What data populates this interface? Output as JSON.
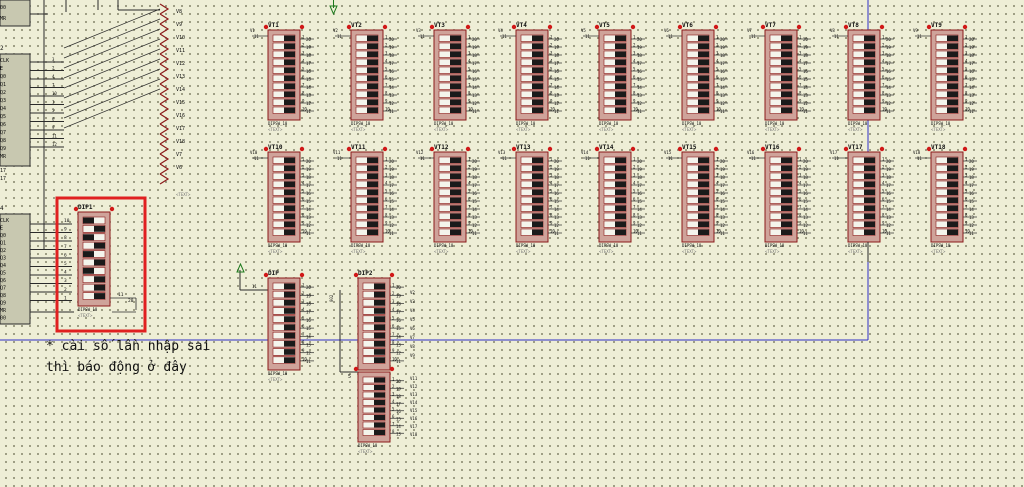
{
  "colors": {
    "background": "#eeeed6",
    "component_border": "#8b1a1a",
    "component_fill": "#cfa39a",
    "switch_on": "#1a1a1a",
    "switch_off": "#f4f4ec",
    "pin_dot": "#d01818",
    "wire": "#2b2b2b",
    "bus_wire": "#3030c8",
    "highlight_box": "#e02020",
    "ground_arrow": "#1d7a1d",
    "ic_fill": "#c8c8b0"
  },
  "ic_left": {
    "top_pins": [
      "00",
      "MR"
    ],
    "mid_label": "2",
    "mid_pins": [
      "CLK",
      "E",
      "Q0",
      "Q1",
      "Q2",
      "Q3",
      "Q4",
      "Q5",
      "Q6",
      "Q7",
      "Q8",
      "Q9",
      "MR"
    ],
    "mid_pin_numbers": [
      "3",
      "2",
      "4",
      "7",
      "10",
      "1",
      "5",
      "6",
      "9",
      "11",
      "12"
    ],
    "bottom_label": "4",
    "bottom_pins": [
      "CLK",
      "E",
      "Q0",
      "Q1",
      "Q2",
      "Q3",
      "Q4",
      "Q5",
      "Q6",
      "Q7",
      "Q8",
      "Q9",
      "MR",
      "00"
    ],
    "extra_labels": [
      "17",
      "17",
      "12",
      "15"
    ]
  },
  "resistor_labels": [
    "V8",
    "V9",
    "V10",
    "V11",
    "V12",
    "V13",
    "V14",
    "V15",
    "V16",
    "V17",
    "V18",
    "V7",
    "V6"
  ],
  "dip_rows": [
    [
      "VT1",
      "VT2",
      "VT3",
      "VT4",
      "VT5",
      "VT6",
      "VT7",
      "VT8",
      "VT9"
    ],
    [
      "VT10",
      "VT11",
      "VT12",
      "VT13",
      "VT14",
      "VT15",
      "VT16",
      "VT17",
      "VT18"
    ]
  ],
  "dip_input_labels": [
    [
      "V1",
      "V2",
      "V3",
      "V4",
      "V5",
      "V6",
      "V7",
      "V8",
      "V9"
    ],
    [
      "V10",
      "V11",
      "V12",
      "V13",
      "V14",
      "V15",
      "V16",
      "V17",
      "V18"
    ]
  ],
  "dip_footer": "DIPSW_10",
  "dip_text_marker": "<TEXT>",
  "dip_pin_numbers": [
    "1",
    "2",
    "3",
    "4",
    "5",
    "6",
    "7",
    "8",
    "9",
    "10"
  ],
  "dip_right_numbers": [
    "20",
    "19",
    "18",
    "17",
    "16",
    "15",
    "14",
    "13",
    "12",
    "11"
  ],
  "dip_top_pin": "11",
  "highlighted_dip": {
    "title": "DIP1",
    "footer": "DIPSW_10",
    "left_numbers": [
      "10",
      "9",
      "8",
      "7",
      "6",
      "5",
      "4",
      "3",
      "2",
      "1"
    ],
    "right_label": "11",
    "right_pin": "20",
    "switch_states": [
      false,
      true,
      false,
      true,
      false,
      true,
      false,
      true,
      true,
      true
    ]
  },
  "dip_bottom_left": {
    "title": "DIP",
    "footer": "DIPSW_10"
  },
  "dip_bottom_mid": {
    "title": "DIP2",
    "footer": "DIPSW_10",
    "pins_right_top": [
      "V2",
      "V3",
      "V4",
      "V5",
      "V6",
      "V7",
      "V8",
      "V9"
    ],
    "pins_right_bottom": [
      "V11",
      "V12",
      "V13",
      "V14",
      "V15",
      "V16",
      "V17",
      "V18"
    ]
  },
  "annotation": {
    "line1": "* cài số lần nhập sai",
    "line2": "thì báo động ở đây"
  }
}
